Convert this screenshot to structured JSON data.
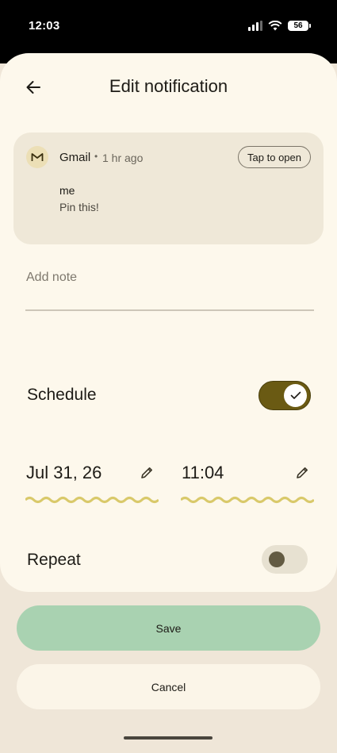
{
  "status_bar": {
    "time": "12:03",
    "battery": "56"
  },
  "header": {
    "title": "Edit notification",
    "back_icon": "arrow-back-icon"
  },
  "notification": {
    "app_icon": "gmail-icon",
    "app_name": "Gmail",
    "separator": "•",
    "time_ago": "1 hr ago",
    "open_label": "Tap to open",
    "title": "me",
    "text": "Pin this!"
  },
  "note": {
    "placeholder": "Add note"
  },
  "schedule": {
    "label": "Schedule",
    "enabled": true,
    "date": "Jul 31, 26",
    "time": "11:04"
  },
  "repeat": {
    "label": "Repeat",
    "enabled": false
  },
  "actions": {
    "save_label": "Save",
    "cancel_label": "Cancel"
  },
  "colors": {
    "accent": "#6a5a13",
    "save": "#a9d2b1",
    "sheet": "#fdf8ec",
    "wave": "#d9c96a"
  }
}
